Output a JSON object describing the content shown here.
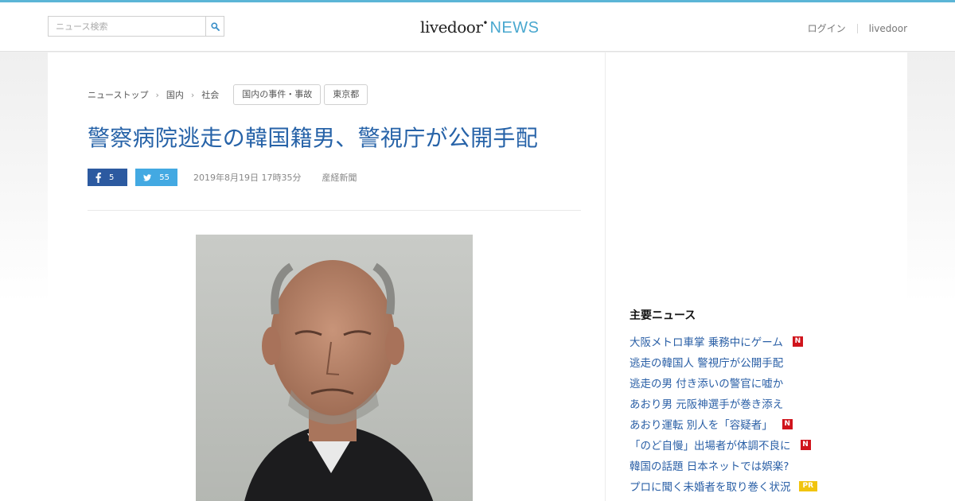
{
  "header": {
    "search_placeholder": "ニュース検索",
    "logo_main": "livedoor",
    "logo_news": "NEWS",
    "login_label": "ログイン",
    "livedoor_link": "livedoor"
  },
  "breadcrumb": {
    "items": [
      "ニューストップ",
      "国内",
      "社会"
    ],
    "tags": [
      "国内の事件・事故",
      "東京都"
    ]
  },
  "article": {
    "title": "警察病院逃走の韓国籍男、警視庁が公開手配",
    "facebook_count": "5",
    "twitter_count": "55",
    "date": "2019年8月19日 17時35分",
    "source": "産経新聞"
  },
  "sidebar": {
    "heading": "主要ニュース",
    "news": [
      {
        "text": "大阪メトロ車掌 乗務中にゲーム",
        "badge": "N"
      },
      {
        "text": "逃走の韓国人 警視庁が公開手配",
        "badge": ""
      },
      {
        "text": "逃走の男 付き添いの警官に嘘か",
        "badge": ""
      },
      {
        "text": "あおり男 元阪神選手が巻き添え",
        "badge": ""
      },
      {
        "text": "あおり運転 別人を「容疑者」",
        "badge": "N"
      },
      {
        "text": "「のど自慢」出場者が体調不良に",
        "badge": "N"
      },
      {
        "text": "韓国の話題 日本ネットでは娯楽?",
        "badge": ""
      },
      {
        "text": "プロに聞く未婚者を取り巻く状況",
        "badge": "PR"
      }
    ]
  },
  "colors": {
    "accent_bar": "#5bb5d6",
    "title_blue": "#2763a8",
    "facebook": "#2c5aa0",
    "twitter": "#43a9e2",
    "badge_new": "#d0141c",
    "badge_pr": "#f1c40f"
  }
}
